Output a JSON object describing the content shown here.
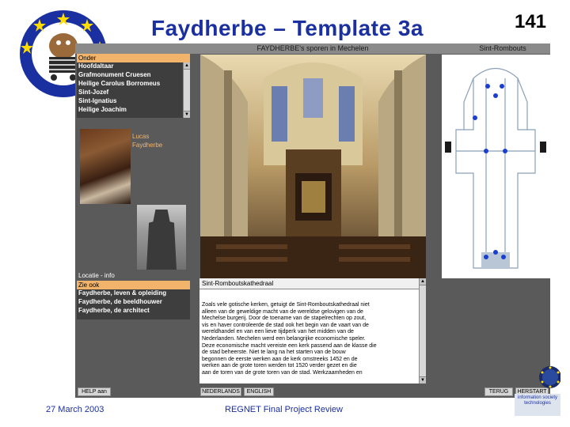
{
  "slide": {
    "title": "Faydherbe – Template 3a",
    "number": "141",
    "footer_date": "27 March 2003",
    "footer_center": "REGNET Final Project Review"
  },
  "app": {
    "top_title": "FAYDHERBE's sporen in Mechelen",
    "top_right": "Sint-Rombouts",
    "onder_header": "Onder",
    "menu_items": [
      "Hoofdaltaar",
      "Grafmonument Cruesen",
      "Heilige Carolus Borromeus",
      "Sint-Jozef",
      "Sint-Ignatius",
      "Heilige Joachim"
    ],
    "portrait_caption_line1": "Lucas",
    "portrait_caption_line2": "Faydherbe",
    "location_label": "Locatie - info",
    "zie_header": "Zie ook",
    "zie_items": [
      "Faydherbe, leven & opleiding",
      "Faydherbe, de beeldhouwer",
      "Faydherbe, de architect"
    ],
    "info_heading": "Sint-Romboutskathedraal",
    "info_lines": [
      "Zoals vele gotische kerken, getuigt de Sint-Romboutskathedraal niet",
      "alleen van de geweldige macht van de wereldse gelovigen van de",
      "Mechelse burgerij. Door de toename van de stapelrechten op zout,",
      "vis en haver controleerde de stad ook het begin van de vaart van de",
      "wereldhandel en van een lieve tijdperk van het midden van de",
      "Nederlanden. Mechelen werd een belangrijke economische speler.",
      "Deze economische macht vereiste een kerk passend aan de klasse die",
      "de stad beheerste. Niet te lang na het starten van de bouw",
      "begonnen de eerste werken aan de kerk omstreeks 1452 en de",
      "werken aan de grote toren werden tot 1520 verder gezet en die",
      "aan de toren van de grote toren van de stad. Werkzaamheden en"
    ],
    "buttons": {
      "help": "HELP aan",
      "nederlands": "NEDERLANDS",
      "english": "ENGLISH",
      "terug": "TERUG",
      "herstart": "HERSTART"
    }
  },
  "ist_logo_text": "information society technologies",
  "colors": {
    "title_blue": "#1a2fa0",
    "app_background": "#5a5a5a",
    "menu_header": "#f2b46a"
  }
}
